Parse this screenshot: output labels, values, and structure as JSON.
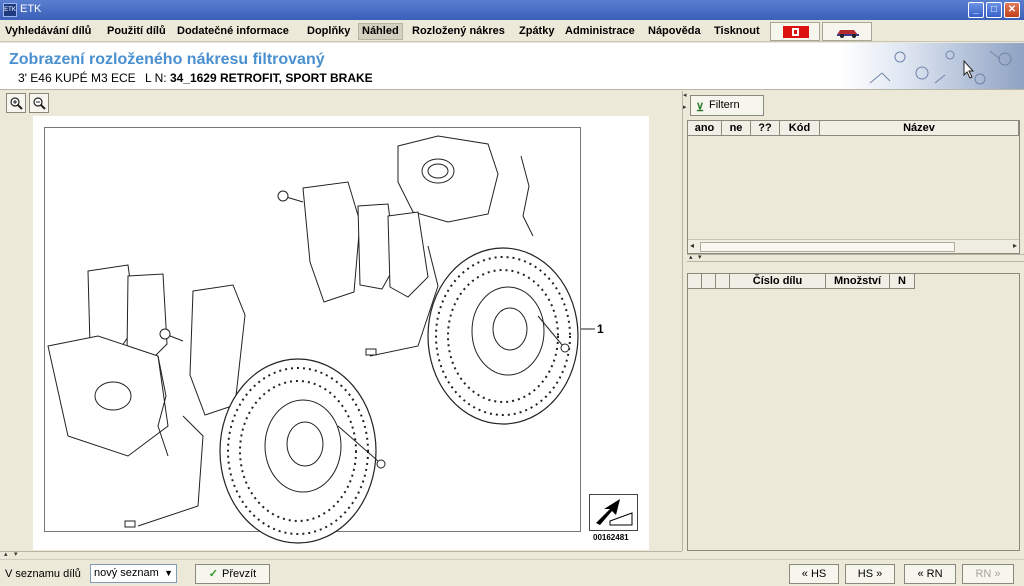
{
  "window": {
    "title": "ETK",
    "app_icon_text": "ETK",
    "minimize_glyph": "_",
    "maximize_glyph": "□",
    "close_glyph": "✕"
  },
  "menu": {
    "items": [
      "Vyhledávání dílů",
      "Použití dílů",
      "Dodatečné informace",
      "Doplňky",
      "Náhled",
      "Rozložený nákres",
      "Zpátky",
      "Administrace",
      "Nápověda",
      "Tisknout"
    ],
    "active_item": "Náhled",
    "flag_buttons": [
      "flag-cz",
      "flag-car"
    ]
  },
  "header": {
    "title": "Zobrazení rozloženého nákresu filtrovaný",
    "model": "3' E46 KUPÉ M3 ECE",
    "ln_label": "L N:",
    "ln_value": "34_1629 RETROFIT, SPORT BRAKE"
  },
  "drawing": {
    "zoom_in_icon": "zoom-in-icon",
    "zoom_out_icon": "zoom-out-icon",
    "callout": "1",
    "diagram_id": "00162481"
  },
  "filter": {
    "button_label": "Filtern",
    "columns": [
      "ano",
      "ne",
      "??",
      "Kód",
      "Název"
    ]
  },
  "parts_table": {
    "columns": [
      "",
      "",
      "",
      "Číslo dílu",
      "Množství",
      "N"
    ]
  },
  "status": {
    "list_label": "V seznamu dílů",
    "list_value": "nový seznam",
    "apply_label": "Převzít",
    "nav_buttons": [
      {
        "label": "« HS",
        "enabled": true
      },
      {
        "label": "HS »",
        "enabled": true
      },
      {
        "label": "« RN",
        "enabled": true
      },
      {
        "label": "RN »",
        "enabled": false
      }
    ]
  }
}
